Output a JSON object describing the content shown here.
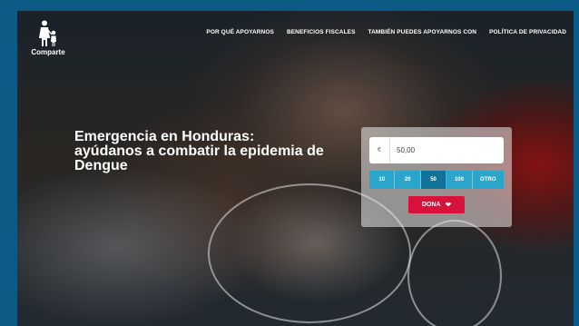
{
  "brand": {
    "name": "Comparte"
  },
  "nav": {
    "items": [
      "POR QUÉ APOYARNOS",
      "BENEFICIOS FISCALES",
      "TAMBIÉN PUEDES APOYARNOS CON",
      "POLÍTICA DE PRIVACIDAD"
    ]
  },
  "hero": {
    "headline_line1": "Emergencia en Honduras:",
    "headline_line2": "ayúdanos a combatir la epidemia de",
    "headline_line3": "Dengue"
  },
  "donation": {
    "currency_symbol": "€",
    "amount_value": "50,00",
    "amounts": [
      "10",
      "20",
      "50",
      "100",
      "OTRO"
    ],
    "selected_amount": "50",
    "button_label": "DONA",
    "button_icon": "heart-icon",
    "accent_color": "#2aa6cc",
    "selected_color": "#10749a",
    "button_color": "#d8123a"
  },
  "colors": {
    "page_border": "#0b5b86"
  }
}
